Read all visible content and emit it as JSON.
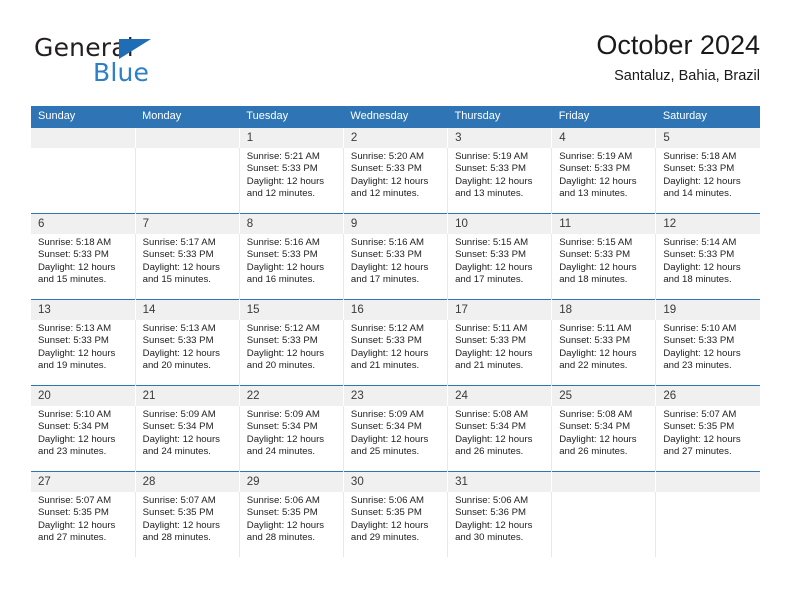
{
  "brand": {
    "name_top": "General",
    "name_bottom": "Blue",
    "triangle_color": "#1f6db5",
    "blue_color": "#2b80c8"
  },
  "header": {
    "title": "October 2024",
    "subtitle": "Santaluz, Bahia, Brazil"
  },
  "theme": {
    "header_blue": "#2f75b5",
    "daynum_band": "#f0f0f0",
    "cell_bg": "#ffffff"
  },
  "calendar": {
    "weekday_headers": [
      "Sunday",
      "Monday",
      "Tuesday",
      "Wednesday",
      "Thursday",
      "Friday",
      "Saturday"
    ],
    "weeks": [
      [
        {
          "day": "",
          "lines": []
        },
        {
          "day": "",
          "lines": []
        },
        {
          "day": "1",
          "lines": [
            "Sunrise: 5:21 AM",
            "Sunset: 5:33 PM",
            "Daylight: 12 hours",
            "and 12 minutes."
          ]
        },
        {
          "day": "2",
          "lines": [
            "Sunrise: 5:20 AM",
            "Sunset: 5:33 PM",
            "Daylight: 12 hours",
            "and 12 minutes."
          ]
        },
        {
          "day": "3",
          "lines": [
            "Sunrise: 5:19 AM",
            "Sunset: 5:33 PM",
            "Daylight: 12 hours",
            "and 13 minutes."
          ]
        },
        {
          "day": "4",
          "lines": [
            "Sunrise: 5:19 AM",
            "Sunset: 5:33 PM",
            "Daylight: 12 hours",
            "and 13 minutes."
          ]
        },
        {
          "day": "5",
          "lines": [
            "Sunrise: 5:18 AM",
            "Sunset: 5:33 PM",
            "Daylight: 12 hours",
            "and 14 minutes."
          ]
        }
      ],
      [
        {
          "day": "6",
          "lines": [
            "Sunrise: 5:18 AM",
            "Sunset: 5:33 PM",
            "Daylight: 12 hours",
            "and 15 minutes."
          ]
        },
        {
          "day": "7",
          "lines": [
            "Sunrise: 5:17 AM",
            "Sunset: 5:33 PM",
            "Daylight: 12 hours",
            "and 15 minutes."
          ]
        },
        {
          "day": "8",
          "lines": [
            "Sunrise: 5:16 AM",
            "Sunset: 5:33 PM",
            "Daylight: 12 hours",
            "and 16 minutes."
          ]
        },
        {
          "day": "9",
          "lines": [
            "Sunrise: 5:16 AM",
            "Sunset: 5:33 PM",
            "Daylight: 12 hours",
            "and 17 minutes."
          ]
        },
        {
          "day": "10",
          "lines": [
            "Sunrise: 5:15 AM",
            "Sunset: 5:33 PM",
            "Daylight: 12 hours",
            "and 17 minutes."
          ]
        },
        {
          "day": "11",
          "lines": [
            "Sunrise: 5:15 AM",
            "Sunset: 5:33 PM",
            "Daylight: 12 hours",
            "and 18 minutes."
          ]
        },
        {
          "day": "12",
          "lines": [
            "Sunrise: 5:14 AM",
            "Sunset: 5:33 PM",
            "Daylight: 12 hours",
            "and 18 minutes."
          ]
        }
      ],
      [
        {
          "day": "13",
          "lines": [
            "Sunrise: 5:13 AM",
            "Sunset: 5:33 PM",
            "Daylight: 12 hours",
            "and 19 minutes."
          ]
        },
        {
          "day": "14",
          "lines": [
            "Sunrise: 5:13 AM",
            "Sunset: 5:33 PM",
            "Daylight: 12 hours",
            "and 20 minutes."
          ]
        },
        {
          "day": "15",
          "lines": [
            "Sunrise: 5:12 AM",
            "Sunset: 5:33 PM",
            "Daylight: 12 hours",
            "and 20 minutes."
          ]
        },
        {
          "day": "16",
          "lines": [
            "Sunrise: 5:12 AM",
            "Sunset: 5:33 PM",
            "Daylight: 12 hours",
            "and 21 minutes."
          ]
        },
        {
          "day": "17",
          "lines": [
            "Sunrise: 5:11 AM",
            "Sunset: 5:33 PM",
            "Daylight: 12 hours",
            "and 21 minutes."
          ]
        },
        {
          "day": "18",
          "lines": [
            "Sunrise: 5:11 AM",
            "Sunset: 5:33 PM",
            "Daylight: 12 hours",
            "and 22 minutes."
          ]
        },
        {
          "day": "19",
          "lines": [
            "Sunrise: 5:10 AM",
            "Sunset: 5:33 PM",
            "Daylight: 12 hours",
            "and 23 minutes."
          ]
        }
      ],
      [
        {
          "day": "20",
          "lines": [
            "Sunrise: 5:10 AM",
            "Sunset: 5:34 PM",
            "Daylight: 12 hours",
            "and 23 minutes."
          ]
        },
        {
          "day": "21",
          "lines": [
            "Sunrise: 5:09 AM",
            "Sunset: 5:34 PM",
            "Daylight: 12 hours",
            "and 24 minutes."
          ]
        },
        {
          "day": "22",
          "lines": [
            "Sunrise: 5:09 AM",
            "Sunset: 5:34 PM",
            "Daylight: 12 hours",
            "and 24 minutes."
          ]
        },
        {
          "day": "23",
          "lines": [
            "Sunrise: 5:09 AM",
            "Sunset: 5:34 PM",
            "Daylight: 12 hours",
            "and 25 minutes."
          ]
        },
        {
          "day": "24",
          "lines": [
            "Sunrise: 5:08 AM",
            "Sunset: 5:34 PM",
            "Daylight: 12 hours",
            "and 26 minutes."
          ]
        },
        {
          "day": "25",
          "lines": [
            "Sunrise: 5:08 AM",
            "Sunset: 5:34 PM",
            "Daylight: 12 hours",
            "and 26 minutes."
          ]
        },
        {
          "day": "26",
          "lines": [
            "Sunrise: 5:07 AM",
            "Sunset: 5:35 PM",
            "Daylight: 12 hours",
            "and 27 minutes."
          ]
        }
      ],
      [
        {
          "day": "27",
          "lines": [
            "Sunrise: 5:07 AM",
            "Sunset: 5:35 PM",
            "Daylight: 12 hours",
            "and 27 minutes."
          ]
        },
        {
          "day": "28",
          "lines": [
            "Sunrise: 5:07 AM",
            "Sunset: 5:35 PM",
            "Daylight: 12 hours",
            "and 28 minutes."
          ]
        },
        {
          "day": "29",
          "lines": [
            "Sunrise: 5:06 AM",
            "Sunset: 5:35 PM",
            "Daylight: 12 hours",
            "and 28 minutes."
          ]
        },
        {
          "day": "30",
          "lines": [
            "Sunrise: 5:06 AM",
            "Sunset: 5:35 PM",
            "Daylight: 12 hours",
            "and 29 minutes."
          ]
        },
        {
          "day": "31",
          "lines": [
            "Sunrise: 5:06 AM",
            "Sunset: 5:36 PM",
            "Daylight: 12 hours",
            "and 30 minutes."
          ]
        },
        {
          "day": "",
          "lines": []
        },
        {
          "day": "",
          "lines": []
        }
      ]
    ]
  }
}
